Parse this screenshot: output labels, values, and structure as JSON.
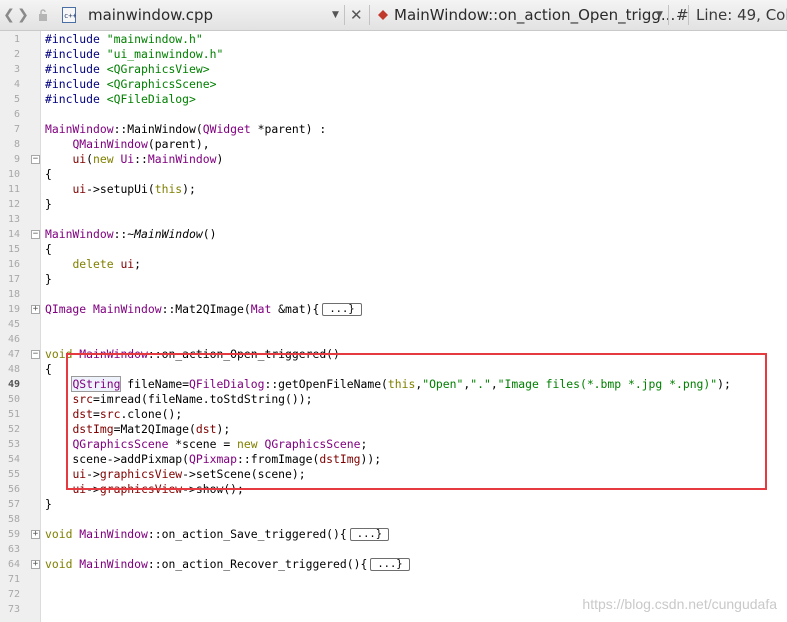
{
  "toolbar": {
    "file_name": "mainwindow.cpp",
    "function_name": "MainWindow::on_action_Open_trigg...",
    "function_symbol": "#",
    "line_info": "Line: 49, Col:"
  },
  "gutter": {
    "line_numbers": [
      "1",
      "2",
      "3",
      "4",
      "5",
      "6",
      "7",
      "8",
      "9",
      "10",
      "11",
      "12",
      "13",
      "14",
      "15",
      "16",
      "17",
      "18",
      "19",
      "45",
      "46",
      "47",
      "48",
      "49",
      "50",
      "51",
      "52",
      "53",
      "54",
      "55",
      "56",
      "57",
      "58",
      "59",
      "63",
      "64",
      "71",
      "72",
      "73"
    ],
    "current_line": "49",
    "fold_markers": [
      {
        "line": "9",
        "symbol": "−"
      },
      {
        "line": "14",
        "symbol": "−"
      },
      {
        "line": "19",
        "symbol": "+"
      },
      {
        "line": "47",
        "symbol": "−"
      },
      {
        "line": "59",
        "symbol": "+"
      },
      {
        "line": "64",
        "symbol": "+"
      }
    ]
  },
  "colors": {
    "keyword": "#808000",
    "class": "#800080",
    "string": "#008000",
    "member": "#800000",
    "ident": "#000080",
    "text": "#000000",
    "gutter_bg": "#efefef",
    "highlight_border": "#e53a3f"
  },
  "code": [
    [
      [
        "#include ",
        "ident"
      ],
      [
        "\"mainwindow.h\"",
        "string"
      ]
    ],
    [
      [
        "#include ",
        "ident"
      ],
      [
        "\"ui_mainwindow.h\"",
        "string"
      ]
    ],
    [
      [
        "#include ",
        "ident"
      ],
      [
        "<QGraphicsView>",
        "string"
      ]
    ],
    [
      [
        "#include ",
        "ident"
      ],
      [
        "<QGraphicsScene>",
        "string"
      ]
    ],
    [
      [
        "#include ",
        "ident"
      ],
      [
        "<QFileDialog>",
        "string"
      ]
    ],
    [],
    [
      [
        "MainWindow",
        "class"
      ],
      [
        "::",
        "text"
      ],
      [
        "MainWindow",
        "text"
      ],
      [
        "(",
        "text"
      ],
      [
        "QWidget",
        "class"
      ],
      [
        " *parent) :",
        "text"
      ]
    ],
    [
      [
        "    ",
        "text"
      ],
      [
        "QMainWindow",
        "class"
      ],
      [
        "(parent),",
        "text"
      ]
    ],
    [
      [
        "    ",
        "text"
      ],
      [
        "ui",
        "member"
      ],
      [
        "(",
        "text"
      ],
      [
        "new",
        "keyword"
      ],
      [
        " ",
        "text"
      ],
      [
        "Ui",
        "class"
      ],
      [
        "::",
        "text"
      ],
      [
        "MainWindow",
        "class"
      ],
      [
        ")",
        "text"
      ]
    ],
    [
      [
        "{",
        "text"
      ]
    ],
    [
      [
        "    ",
        "text"
      ],
      [
        "ui",
        "member"
      ],
      [
        "->setupUi(",
        "text"
      ],
      [
        "this",
        "keyword"
      ],
      [
        ");",
        "text"
      ]
    ],
    [
      [
        "}",
        "text"
      ]
    ],
    [],
    [
      [
        "MainWindow",
        "class"
      ],
      [
        "::~",
        "text"
      ],
      [
        "MainWindow",
        "italic"
      ],
      [
        "()",
        "text"
      ]
    ],
    [
      [
        "{",
        "text"
      ]
    ],
    [
      [
        "    ",
        "text"
      ],
      [
        "delete",
        "keyword"
      ],
      [
        " ",
        "text"
      ],
      [
        "ui",
        "member"
      ],
      [
        ";",
        "text"
      ]
    ],
    [
      [
        "}",
        "text"
      ]
    ],
    [],
    [
      [
        "QImage",
        "class"
      ],
      [
        " ",
        "text"
      ],
      [
        "MainWindow",
        "class"
      ],
      [
        "::Mat2QImage(",
        "text"
      ],
      [
        "Mat",
        "class"
      ],
      [
        " &mat){",
        "text"
      ],
      [
        "...}",
        "folded"
      ]
    ],
    [],
    [],
    [
      [
        "void",
        "keyword"
      ],
      [
        " ",
        "text"
      ],
      [
        "MainWindow",
        "class"
      ],
      [
        "::on_action_Open_triggered()",
        "text"
      ]
    ],
    [
      [
        "{",
        "text"
      ]
    ],
    [
      [
        "    ",
        "text"
      ],
      [
        "QString",
        "class-hl"
      ],
      [
        " fileName=",
        "text"
      ],
      [
        "QFileDialog",
        "class"
      ],
      [
        "::getOpenFileName(",
        "text"
      ],
      [
        "this",
        "keyword"
      ],
      [
        ",",
        "text"
      ],
      [
        "\"Open\"",
        "string"
      ],
      [
        ",",
        "text"
      ],
      [
        "\".\"",
        "string"
      ],
      [
        ",",
        "text"
      ],
      [
        "\"Image files(*.bmp *.jpg *.png)\"",
        "string"
      ],
      [
        ");",
        "text"
      ]
    ],
    [
      [
        "    ",
        "text"
      ],
      [
        "src",
        "member"
      ],
      [
        "=imread(fileName.toStdString());",
        "text"
      ]
    ],
    [
      [
        "    ",
        "text"
      ],
      [
        "dst",
        "member"
      ],
      [
        "=",
        "text"
      ],
      [
        "src",
        "member"
      ],
      [
        ".clone();",
        "text"
      ]
    ],
    [
      [
        "    ",
        "text"
      ],
      [
        "dstImg",
        "member"
      ],
      [
        "=Mat2QImage(",
        "text"
      ],
      [
        "dst",
        "member"
      ],
      [
        ");",
        "text"
      ]
    ],
    [
      [
        "    ",
        "text"
      ],
      [
        "QGraphicsScene",
        "class"
      ],
      [
        " *scene = ",
        "text"
      ],
      [
        "new",
        "keyword"
      ],
      [
        " ",
        "text"
      ],
      [
        "QGraphicsScene",
        "class"
      ],
      [
        ";",
        "text"
      ]
    ],
    [
      [
        "    scene->addPixmap(",
        "text"
      ],
      [
        "QPixmap",
        "class"
      ],
      [
        "::fromImage(",
        "text"
      ],
      [
        "dstImg",
        "member"
      ],
      [
        "));",
        "text"
      ]
    ],
    [
      [
        "    ",
        "text"
      ],
      [
        "ui",
        "member"
      ],
      [
        "->",
        "text"
      ],
      [
        "graphicsView",
        "member"
      ],
      [
        "->setScene(scene);",
        "text"
      ]
    ],
    [
      [
        "    ",
        "text"
      ],
      [
        "ui",
        "member"
      ],
      [
        "->",
        "text"
      ],
      [
        "graphicsView",
        "member"
      ],
      [
        "->show();",
        "text"
      ]
    ],
    [
      [
        "}",
        "text"
      ]
    ],
    [],
    [
      [
        "void",
        "keyword"
      ],
      [
        " ",
        "text"
      ],
      [
        "MainWindow",
        "class"
      ],
      [
        "::on_action_Save_triggered(){",
        "text"
      ],
      [
        "...}",
        "folded"
      ]
    ],
    [],
    [
      [
        "void",
        "keyword"
      ],
      [
        " ",
        "text"
      ],
      [
        "MainWindow",
        "class"
      ],
      [
        "::on_action_Recover_triggered(){",
        "text"
      ],
      [
        "...}",
        "folded"
      ]
    ],
    [],
    [],
    []
  ],
  "watermark": "https://blog.csdn.net/cungudafa"
}
